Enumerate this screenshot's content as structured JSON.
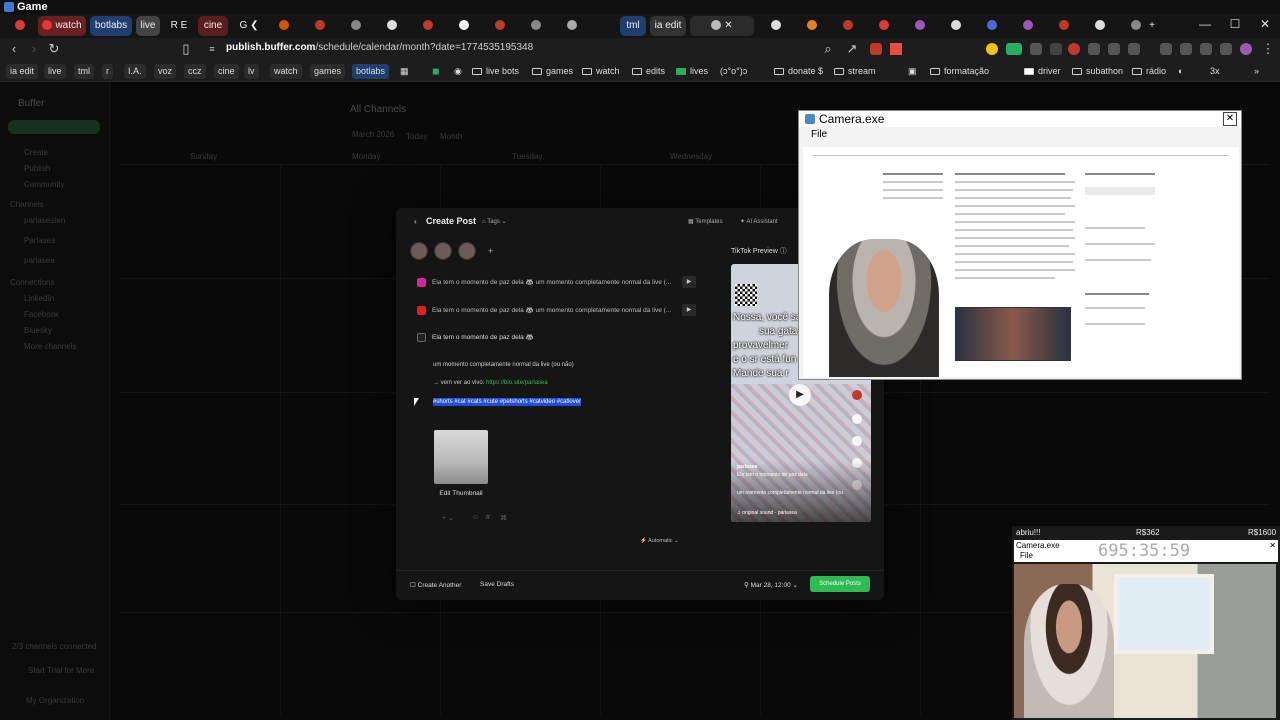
{
  "window": {
    "title": "Game"
  },
  "tabs": [
    {
      "label": "",
      "color": "#e23a3a"
    },
    {
      "label": "watch",
      "color": "#e23a3a"
    },
    {
      "label": "botlabs",
      "color": "#2e6fd8"
    },
    {
      "label": "live",
      "color": "#888888"
    },
    {
      "label": "R E",
      "color": "#4a6bd8"
    },
    {
      "label": "cine",
      "color": "#c0392b"
    },
    {
      "label": "G ❮",
      "color": "#2e9b5a"
    },
    {
      "label": "",
      "color": "#d35400"
    },
    {
      "label": "",
      "color": "#c0392b"
    },
    {
      "label": "",
      "color": "#888888"
    },
    {
      "label": "",
      "color": "#dddddd"
    },
    {
      "label": "",
      "color": "#c0392b"
    },
    {
      "label": "",
      "color": "#ffffff"
    },
    {
      "label": "",
      "color": "#c0392b"
    },
    {
      "label": "",
      "color": "#888888"
    },
    {
      "label": "tml",
      "color": "#2e6fd8"
    },
    {
      "label": "ia edit",
      "color": "#888888"
    },
    {
      "label": "",
      "color": "#aaaaaa"
    }
  ],
  "address": {
    "host": "publish.buffer.com",
    "path": "/schedule/calendar/month?date=1774535195348"
  },
  "bookmarks": [
    {
      "label": "ia edit",
      "pill": true
    },
    {
      "label": "live",
      "pill": true
    },
    {
      "label": "tml",
      "pill": true
    },
    {
      "label": "r",
      "pill": true
    },
    {
      "label": "I.A.",
      "pill": true
    },
    {
      "label": "voz",
      "pill": true
    },
    {
      "label": "ccz",
      "pill": true
    },
    {
      "label": "cine",
      "pill": true
    },
    {
      "label": "lv",
      "pill": true
    },
    {
      "label": "watch",
      "pill": true
    },
    {
      "label": "games",
      "pill": true
    },
    {
      "label": "botlabs",
      "pill": true
    },
    {
      "label": "live bots",
      "folder": true
    },
    {
      "label": "games",
      "folder": true
    },
    {
      "label": "watch",
      "folder": true
    },
    {
      "label": "edits",
      "folder": true
    },
    {
      "label": "lives",
      "folder": true
    },
    {
      "label": "(ↄ°o°)ↄ",
      "folder": false
    },
    {
      "label": "donate $",
      "folder": true
    },
    {
      "label": "stream",
      "folder": true
    },
    {
      "label": "formatação",
      "folder": true
    },
    {
      "label": "driver",
      "folder": true
    },
    {
      "label": "subathon",
      "folder": true
    },
    {
      "label": "rádio",
      "folder": true
    },
    {
      "label": "3x",
      "folder": false
    }
  ],
  "app": {
    "brand": "Buffer",
    "heading": "All Channels",
    "month": "March 2026",
    "today": "Today",
    "view": "Month",
    "weekdays": [
      "Sunday",
      "Monday",
      "Tuesday",
      "Wednesday"
    ],
    "sidebar_items": [
      "Create",
      "Publish",
      "Community",
      "Channels",
      "parlasesten",
      "Parlasea",
      "parlasea",
      "Connections",
      "LinkedIn",
      "Facebook",
      "Bluesky",
      "More channels"
    ],
    "footer": {
      "channels": "2/3 channels connected",
      "trial": "Start Trial for More",
      "org": "My Organization"
    }
  },
  "modal": {
    "title": "Create Post",
    "tags": "Tags",
    "templates": "Templates",
    "assistant": "AI Assistant",
    "channels": [
      {
        "text": "Ela tem o momento de paz dela 🦝 um momento completamente normal da live (...",
        "color": "#d6249f"
      },
      {
        "text": "Ela tem o momento de paz dela 🦝 um momento completamente normal da live (...",
        "color": "#e02020"
      }
    ],
    "editor": {
      "line1": "Ela tem o momento de paz dela 🦝",
      "line2": "um momento completamente normal da live (ou não)",
      "line3_prefix": "→ vem ver ao vivo: ",
      "line3_link": "https://bio.site/parlasea",
      "hashtags": "#shorts #cat #cats #cute #petshorts #catvideo #catlover",
      "link_color": "#2dbb52"
    },
    "thumbnail_label": "Edit Thumbnail",
    "automatic": "Automatic",
    "create_another": "Create Another",
    "save_drafts": "Save Drafts",
    "date": "Mar 28, 12:00",
    "schedule": "Schedule Posts",
    "schedule_color": "#2dbb52",
    "preview": {
      "label": "TikTok Preview",
      "caption_lines": [
        "Nossa, você sa",
        "sua gata",
        "provavelmer",
        "e o sr está fun",
        "Mande sua r"
      ],
      "account": "parlasea",
      "desc1": "Ela tem o momento de paz dela",
      "desc2": "um momento completamente normal da live (ou",
      "sound": "♫ original sound - parlasea"
    }
  },
  "camera_window": {
    "title": "Camera.exe",
    "menu": "File"
  },
  "camera_small": {
    "label_left": "abriu!!!",
    "label_mid": "R$362",
    "label_right": "R$1600",
    "title": "Camera.exe",
    "menu": "File",
    "timer": "695:35:59"
  }
}
